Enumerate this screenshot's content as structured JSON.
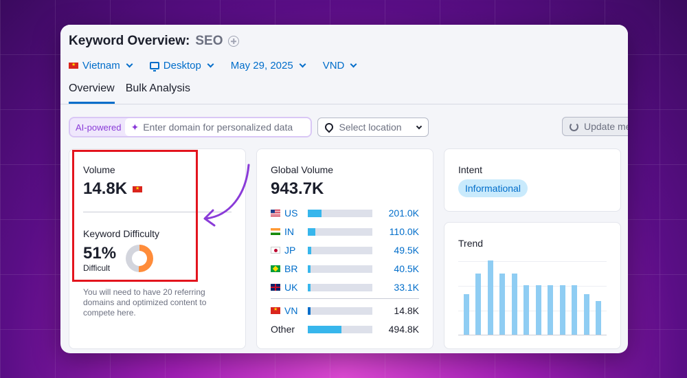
{
  "header": {
    "title_label": "Keyword Overview:",
    "keyword": "SEO",
    "filters": {
      "country": "Vietnam",
      "device": "Desktop",
      "date": "May 29, 2025",
      "currency": "VND"
    },
    "tabs": [
      {
        "label": "Overview",
        "active": true
      },
      {
        "label": "Bulk Analysis",
        "active": false
      }
    ]
  },
  "toolbar": {
    "ai_label": "AI-powered",
    "domain_placeholder": "Enter domain for personalized data",
    "location_placeholder": "Select location",
    "update_label": "Update me"
  },
  "volume_card": {
    "label": "Volume",
    "value": "14.8K",
    "kd_label": "Keyword Difficulty",
    "kd_value": "51%",
    "kd_percent": 51,
    "kd_level": "Difficult",
    "kd_description": "You will need to have 20 referring domains and optimized content to compete here."
  },
  "global_card": {
    "label": "Global Volume",
    "value": "943.7K",
    "countries": [
      {
        "code": "US",
        "value": "201.0K",
        "fraction": 0.213
      },
      {
        "code": "IN",
        "value": "110.0K",
        "fraction": 0.117
      },
      {
        "code": "JP",
        "value": "49.5K",
        "fraction": 0.052
      },
      {
        "code": "BR",
        "value": "40.5K",
        "fraction": 0.043
      },
      {
        "code": "UK",
        "value": "33.1K",
        "fraction": 0.035
      }
    ],
    "local": {
      "code": "VN",
      "value": "14.8K",
      "fraction": 0.016
    },
    "other": {
      "code": "Other",
      "value": "494.8K",
      "fraction": 0.524
    }
  },
  "intent_card": {
    "label": "Intent",
    "badge": "Informational"
  },
  "trend_card": {
    "label": "Trend",
    "values": [
      0.55,
      0.82,
      1.0,
      0.82,
      0.82,
      0.67,
      0.67,
      0.67,
      0.67,
      0.67,
      0.55,
      0.45
    ]
  },
  "colors": {
    "accent": "#006dca",
    "highlight": "#e3141d",
    "arrow": "#8a3bd8",
    "kd_orange": "#ff8c3a",
    "bar_blue": "#37b6ec",
    "trend_blue": "#8fcdf3"
  }
}
